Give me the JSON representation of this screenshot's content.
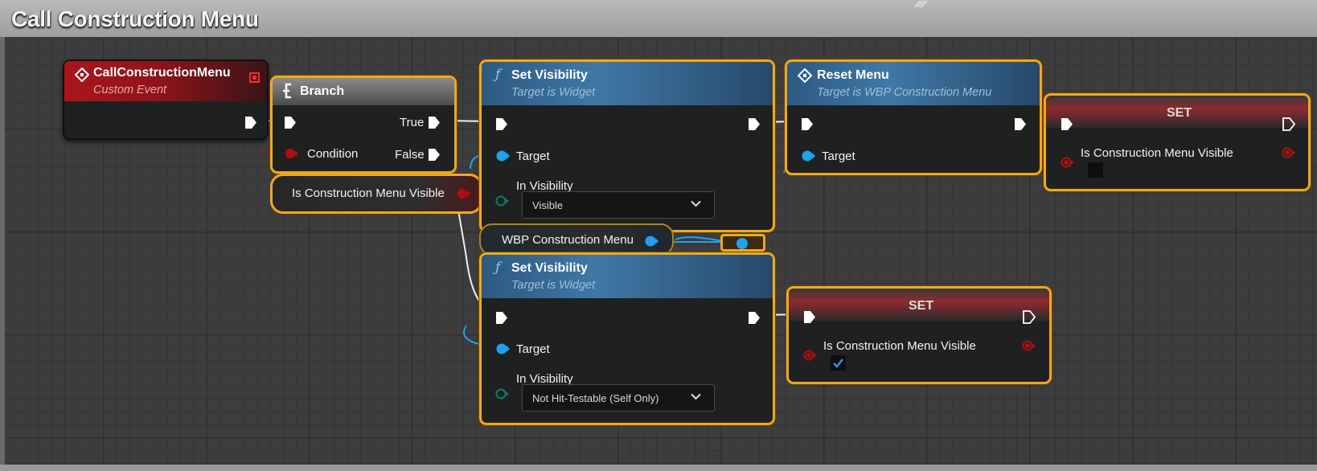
{
  "window": {
    "title": "Call Construction Menu"
  },
  "nodes": {
    "custom_event": {
      "title": "CallConstructionMenu",
      "subtitle": "Custom Event"
    },
    "branch": {
      "title": "Branch",
      "pin_true": "True",
      "pin_false": "False",
      "pin_condition": "Condition"
    },
    "get_visible": {
      "label": "Is Construction Menu Visible"
    },
    "set_visibility_1": {
      "title": "Set Visibility",
      "subtitle": "Target is Widget",
      "pin_target": "Target",
      "pin_in_visibility": "In Visibility",
      "dropdown_value": "Visible"
    },
    "get_wbp": {
      "label": "WBP Construction Menu"
    },
    "set_visibility_2": {
      "title": "Set Visibility",
      "subtitle": "Target is Widget",
      "pin_target": "Target",
      "pin_in_visibility": "In Visibility",
      "dropdown_value": "Not Hit-Testable (Self Only)"
    },
    "reset_menu": {
      "title": "Reset Menu",
      "subtitle": "Target is WBP Construction Menu",
      "pin_target": "Target"
    },
    "set_1": {
      "title": "SET",
      "pin_var": "Is Construction Menu Visible",
      "checked": false
    },
    "set_2": {
      "title": "SET",
      "pin_var": "Is Construction Menu Visible",
      "checked": true
    }
  },
  "colors": {
    "selection": "#f0a81e",
    "exec_pin": "#ffffff",
    "object_pin": "#1ea2ef",
    "bool_pin": "#a20e0e",
    "enum_pin": "#0a6a5e",
    "event_header": "#a8161d",
    "function_header": "#3f78a6"
  }
}
